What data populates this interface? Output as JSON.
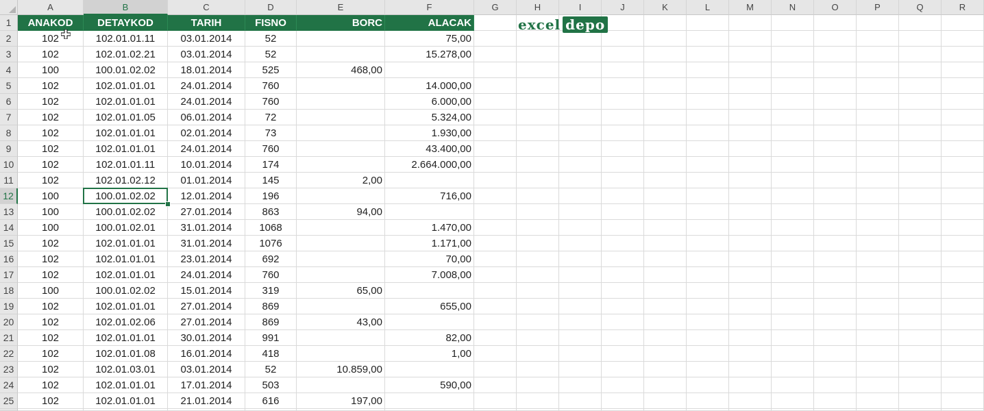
{
  "columns": [
    "A",
    "B",
    "C",
    "D",
    "E",
    "F",
    "G",
    "H",
    "I",
    "J",
    "K",
    "L",
    "M",
    "N",
    "O",
    "P",
    "Q",
    "R"
  ],
  "header": [
    "ANAKOD",
    "DETAYKOD",
    "TARIH",
    "FISNO",
    "BORC",
    "ALACAK"
  ],
  "rows": [
    [
      "102",
      "102.01.01.11",
      "03.01.2014",
      "52",
      "",
      "75,00"
    ],
    [
      "102",
      "102.01.02.21",
      "03.01.2014",
      "52",
      "",
      "15.278,00"
    ],
    [
      "100",
      "100.01.02.02",
      "18.01.2014",
      "525",
      "468,00",
      ""
    ],
    [
      "102",
      "102.01.01.01",
      "24.01.2014",
      "760",
      "",
      "14.000,00"
    ],
    [
      "102",
      "102.01.01.01",
      "24.01.2014",
      "760",
      "",
      "6.000,00"
    ],
    [
      "102",
      "102.01.01.05",
      "06.01.2014",
      "72",
      "",
      "5.324,00"
    ],
    [
      "102",
      "102.01.01.01",
      "02.01.2014",
      "73",
      "",
      "1.930,00"
    ],
    [
      "102",
      "102.01.01.01",
      "24.01.2014",
      "760",
      "",
      "43.400,00"
    ],
    [
      "102",
      "102.01.01.11",
      "10.01.2014",
      "174",
      "",
      "2.664.000,00"
    ],
    [
      "102",
      "102.01.02.12",
      "01.01.2014",
      "145",
      "2,00",
      ""
    ],
    [
      "100",
      "100.01.02.02",
      "12.01.2014",
      "196",
      "",
      "716,00"
    ],
    [
      "100",
      "100.01.02.02",
      "27.01.2014",
      "863",
      "94,00",
      ""
    ],
    [
      "100",
      "100.01.02.01",
      "31.01.2014",
      "1068",
      "",
      "1.470,00"
    ],
    [
      "102",
      "102.01.01.01",
      "31.01.2014",
      "1076",
      "",
      "1.171,00"
    ],
    [
      "102",
      "102.01.01.01",
      "23.01.2014",
      "692",
      "",
      "70,00"
    ],
    [
      "102",
      "102.01.01.01",
      "24.01.2014",
      "760",
      "",
      "7.008,00"
    ],
    [
      "100",
      "100.01.02.02",
      "15.01.2014",
      "319",
      "65,00",
      ""
    ],
    [
      "102",
      "102.01.01.01",
      "27.01.2014",
      "869",
      "",
      "655,00"
    ],
    [
      "102",
      "102.01.02.06",
      "27.01.2014",
      "869",
      "43,00",
      ""
    ],
    [
      "102",
      "102.01.01.01",
      "30.01.2014",
      "991",
      "",
      "82,00"
    ],
    [
      "102",
      "102.01.01.08",
      "16.01.2014",
      "418",
      "",
      "1,00"
    ],
    [
      "102",
      "102.01.03.01",
      "03.01.2014",
      "52",
      "10.859,00",
      ""
    ],
    [
      "102",
      "102.01.01.01",
      "17.01.2014",
      "503",
      "",
      "590,00"
    ],
    [
      "102",
      "102.01.01.01",
      "21.01.2014",
      "616",
      "197,00",
      ""
    ]
  ],
  "active_cell": {
    "col": "B",
    "row": 12
  },
  "logo": {
    "part1": "excel",
    "part2": "depo"
  },
  "colors": {
    "accent": "#217346",
    "grid": "#dadada",
    "header_bg": "#e6e6e6"
  },
  "icons": {
    "cursor": "cell-select-cursor-icon"
  }
}
